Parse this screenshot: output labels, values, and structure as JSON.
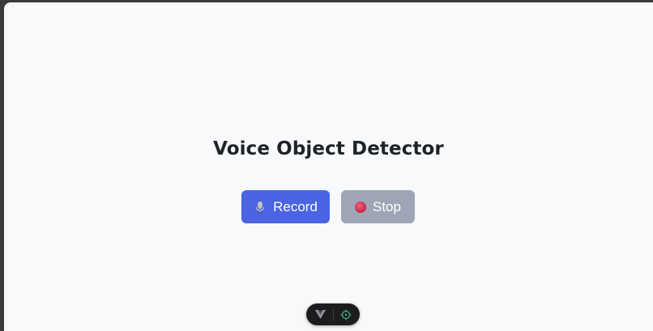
{
  "page": {
    "title": "Voice Object Detector"
  },
  "buttons": {
    "record_label": "Record",
    "record_icon": "microphone-icon",
    "stop_label": "Stop",
    "stop_icon": "record-dot-icon"
  },
  "devtools": {
    "icons": [
      "vue-logo-icon",
      "crosshair-target-icon"
    ],
    "accent": "#42b883"
  },
  "colors": {
    "primary": "#4a64e3",
    "disabled": "#9ea6b6",
    "stop_dot": "#d6305a",
    "background": "#f8f9fb"
  }
}
